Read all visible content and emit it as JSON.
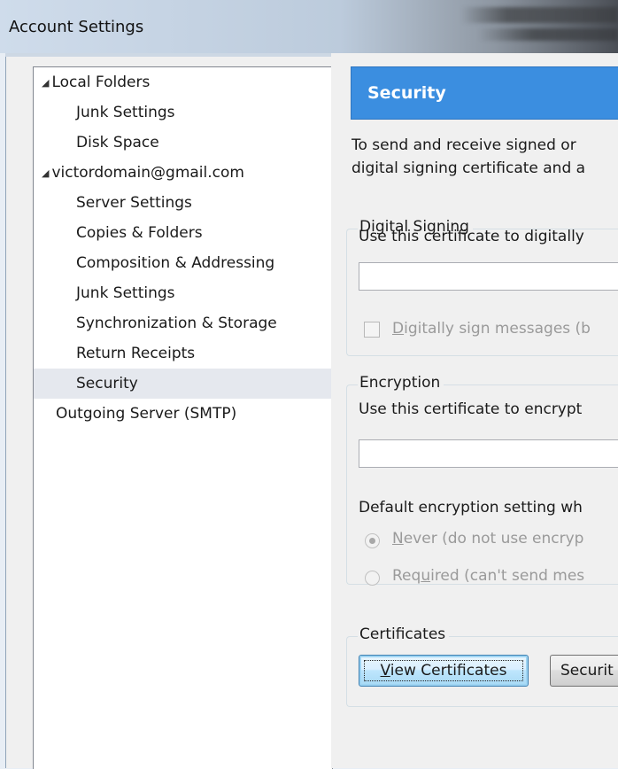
{
  "window": {
    "title": "Account Settings"
  },
  "tree": {
    "items": [
      {
        "label": "Local Folders",
        "level": 0,
        "expanded": true
      },
      {
        "label": "Junk Settings",
        "level": 1
      },
      {
        "label": "Disk Space",
        "level": 1
      },
      {
        "label": "victordomain@gmail.com",
        "level": 0,
        "expanded": true
      },
      {
        "label": "Server Settings",
        "level": 1
      },
      {
        "label": "Copies & Folders",
        "level": 1
      },
      {
        "label": "Composition & Addressing",
        "level": 1
      },
      {
        "label": "Junk Settings",
        "level": 1
      },
      {
        "label": "Synchronization & Storage",
        "level": 1
      },
      {
        "label": "Return Receipts",
        "level": 1
      },
      {
        "label": "Security",
        "level": 1,
        "selected": true
      },
      {
        "label": "Outgoing Server (SMTP)",
        "level": 0
      }
    ]
  },
  "panel": {
    "header": "Security",
    "description_line1": "To send and receive signed or",
    "description_line2": "digital signing certificate and a",
    "digital_signing": {
      "legend": "Digital Signing",
      "cert_label": "Use this certificate to digitally",
      "cert_value": "",
      "checkbox_label_accel": "D",
      "checkbox_label_rest": "igitally sign messages (b",
      "checkbox_checked": false
    },
    "encryption": {
      "legend": "Encryption",
      "cert_label": "Use this certificate to encrypt",
      "cert_value": "",
      "default_label": "Default encryption setting wh",
      "never_accel": "N",
      "never_rest": "ever (do not use encryp",
      "required_pre": "Req",
      "required_accel": "u",
      "required_rest": "ired (can't send mes",
      "selected": "never"
    },
    "certificates": {
      "legend": "Certificates",
      "view_accel": "V",
      "view_rest": "iew Certificates",
      "security_devices": "Securit"
    }
  },
  "colors": {
    "header_bg": "#3b8ee0",
    "selected_row": "#e5e8ee"
  }
}
